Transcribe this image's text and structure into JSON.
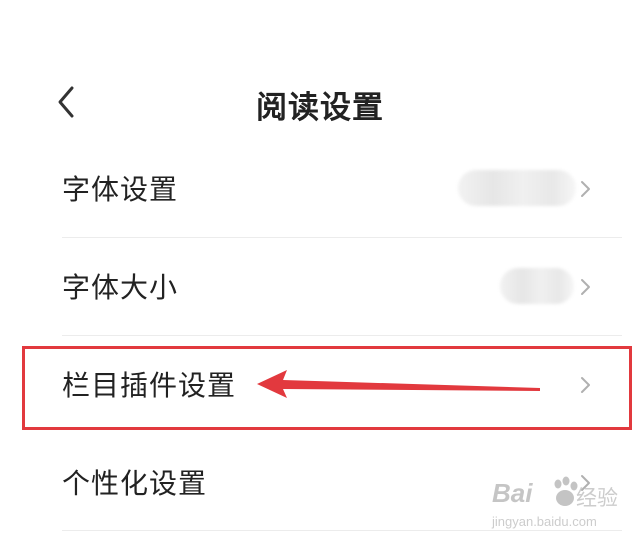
{
  "header": {
    "title": "阅读设置"
  },
  "settings": {
    "items": [
      {
        "label": "字体设置"
      },
      {
        "label": "字体大小"
      },
      {
        "label": "栏目插件设置"
      },
      {
        "label": "个性化设置"
      }
    ]
  },
  "annotation": {
    "box_color": "#e2393e",
    "arrow_color": "#e2393e"
  },
  "watermark": {
    "brand": "Bai",
    "text_cn": "经验",
    "url": "jingyan.baidu.com"
  }
}
